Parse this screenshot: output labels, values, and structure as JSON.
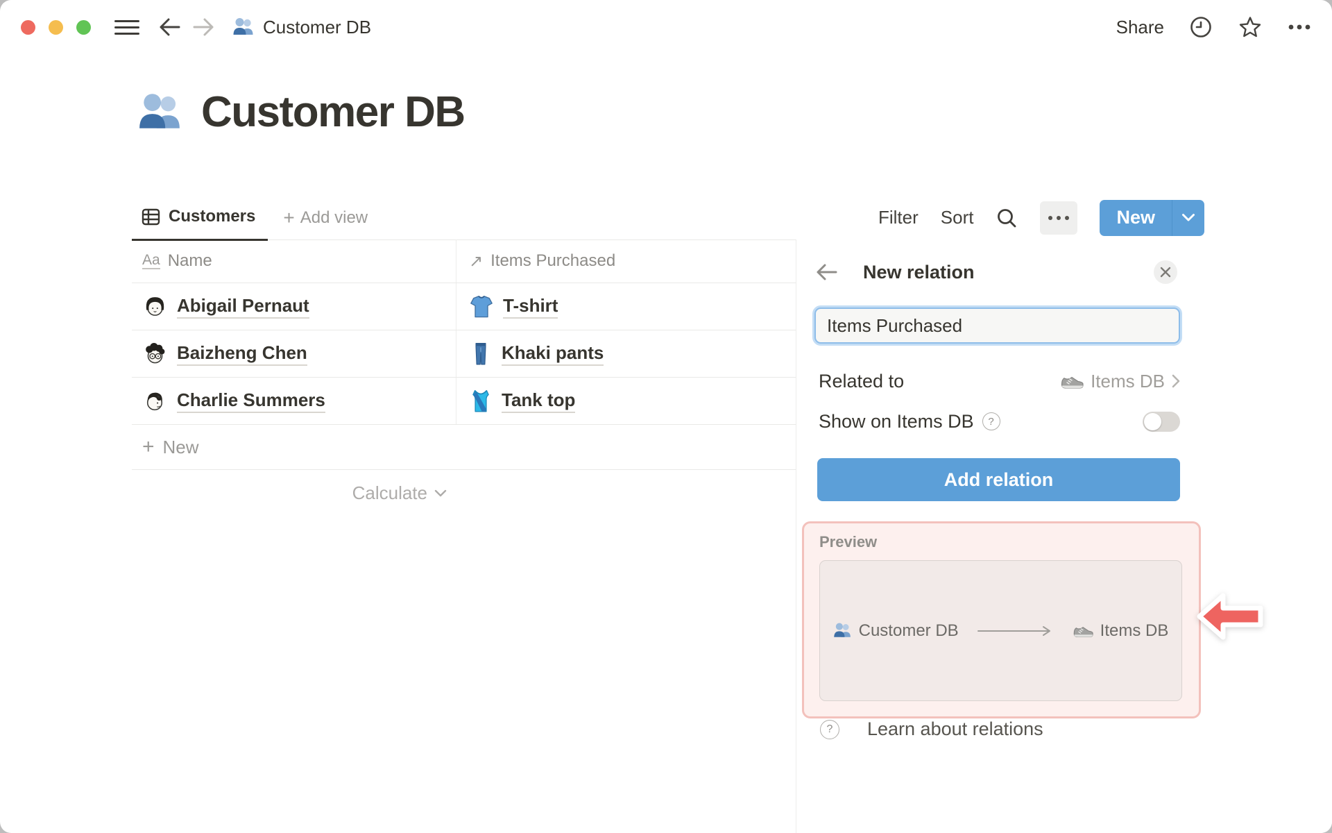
{
  "window": {
    "title": "Customer DB",
    "share_label": "Share"
  },
  "page": {
    "title": "Customer DB"
  },
  "toolbar": {
    "view_tab": "Customers",
    "add_view": "Add view",
    "add_view_plus": "+",
    "filter": "Filter",
    "sort": "Sort",
    "new_button": "New"
  },
  "table": {
    "columns": [
      {
        "icon_label": "Aa",
        "name": "Name"
      },
      {
        "icon_glyph": "↗",
        "name": "Items Purchased"
      }
    ],
    "rows": [
      {
        "name": "Abigail Pernaut",
        "item": "T-shirt"
      },
      {
        "name": "Baizheng Chen",
        "item": "Khaki pants"
      },
      {
        "name": "Charlie Summers",
        "item": "Tank top"
      }
    ],
    "new_row_plus": "+",
    "new_row": "New",
    "calculate": "Calculate"
  },
  "panel": {
    "title": "New relation",
    "name_value": "Items Purchased",
    "related_to_label": "Related to",
    "related_to_value": "Items DB",
    "show_on_label": "Show on Items DB",
    "show_on_enabled": false,
    "help_glyph": "?",
    "add_button": "Add relation",
    "preview_label": "Preview",
    "preview_source": "Customer DB",
    "preview_target": "Items DB",
    "learn_link": "Learn about relations"
  },
  "icons": {
    "page_icon": "busts-in-silhouette",
    "related_db_icon": "sneaker",
    "row_item_icons": [
      "t-shirt",
      "jeans",
      "running-shirt"
    ]
  },
  "colors": {
    "accent_blue": "#5c9fd8",
    "highlight_pink_border": "#f3c1bc",
    "highlight_pink_bg": "#fdf0ee",
    "annotation_arrow_red": "#ee6460",
    "traffic_red": "#ee6a5f",
    "traffic_yellow": "#f5bd4f",
    "traffic_green": "#61c455"
  }
}
